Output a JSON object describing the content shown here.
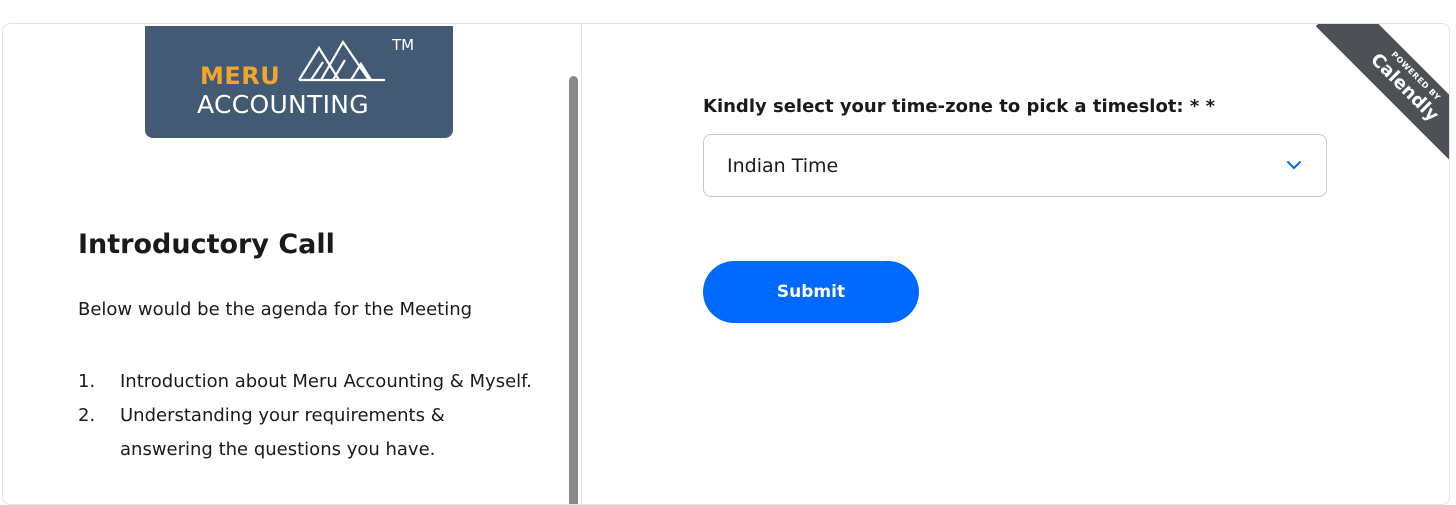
{
  "logo": {
    "word1": "MERU",
    "word2": "ACCOUNTING",
    "trademark": "TM"
  },
  "event": {
    "title": "Introductory Call",
    "description": "Below would be the agenda for the Meeting",
    "agenda": [
      {
        "num": "1.",
        "text": "Introduction about Meru Accounting & Myself."
      },
      {
        "num": "2.",
        "text": "Understanding your requirements & answering the questions you have."
      }
    ]
  },
  "form": {
    "timezone_label": "Kindly select your time-zone to pick a timeslot: * *",
    "timezone_value": "Indian Time",
    "submit_label": "Submit"
  },
  "badge": {
    "powered_by": "POWERED BY",
    "brand": "Calendly"
  },
  "colors": {
    "accent": "#0069ff",
    "logo_bg": "#435a75",
    "logo_orange": "#f2a52c",
    "ribbon_bg": "#4d5054"
  },
  "icons": {
    "dropdown": "chevron-down-icon",
    "logo_mark": "mountains-icon"
  }
}
